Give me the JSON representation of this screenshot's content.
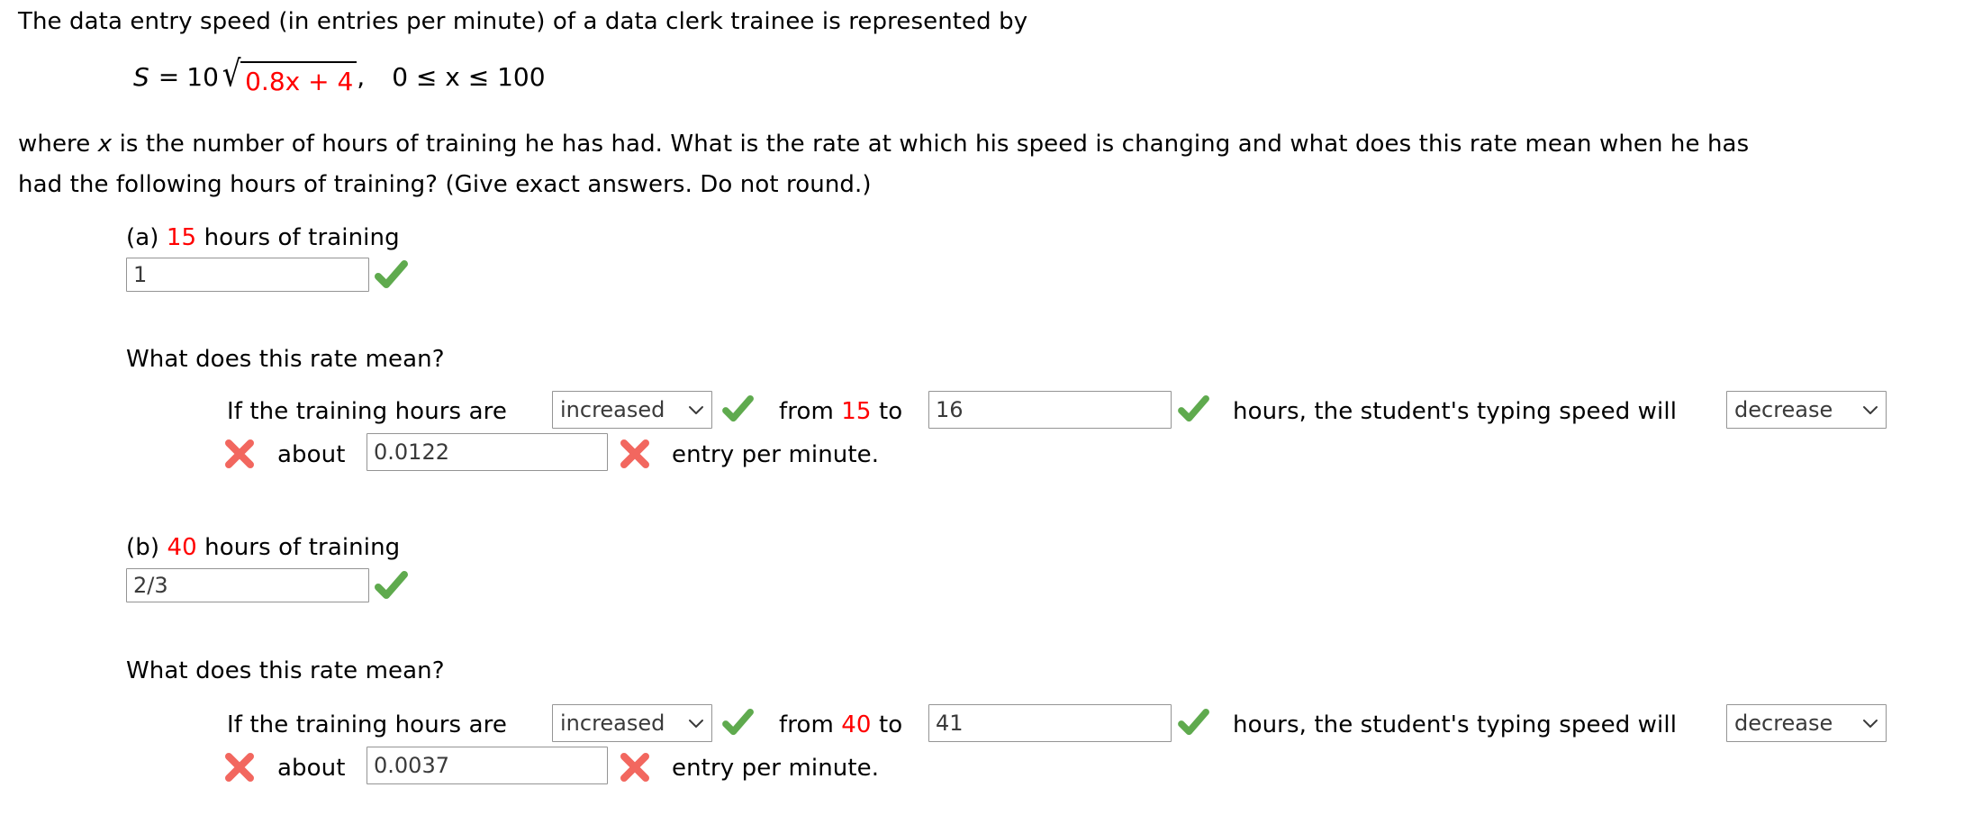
{
  "problem": {
    "intro": "The data entry speed (in entries per minute) of a data clerk trainee is represented by",
    "formula": {
      "lhs": "S",
      "equals": "=",
      "coefficient": "10",
      "radicand": "0.8x + 4",
      "comma": ",",
      "domain": "0 ≤ x ≤ 100"
    },
    "body_line1": "where x is the number of hours of training he has had. What is the rate at which his speed is changing and what does this rate mean when he has",
    "body_line1_prefix": "where ",
    "body_line1_var": "x",
    "body_line1_rest": " is the number of hours of training he has had. What is the rate at which his speed is changing and what does this rate mean when he has",
    "body_line2": "had the following hours of training? (Give exact answers. Do not round.)"
  },
  "parts": [
    {
      "label": "(a)",
      "hours": "15",
      "hours_suffix": "hours of training",
      "answer_value": "1",
      "answer_status": "correct",
      "rate_question": "What does this rate mean?",
      "sentence": {
        "lead": "If the training hours are",
        "direction_select": "increased",
        "direction_status": "correct",
        "from_word": "from",
        "from_value": "15",
        "to_word": "to",
        "to_value": "16",
        "to_status": "correct",
        "mid": "hours, the student's typing speed will",
        "change_select": "decrease",
        "about_status": "incorrect",
        "about_word": "about",
        "amount_value": "0.0122",
        "amount_status": "incorrect",
        "tail": "entry per minute."
      }
    },
    {
      "label": "(b)",
      "hours": "40",
      "hours_suffix": "hours of training",
      "answer_value": "2/3",
      "answer_status": "correct",
      "rate_question": "What does this rate mean?",
      "sentence": {
        "lead": "If the training hours are",
        "direction_select": "increased",
        "direction_status": "correct",
        "from_word": "from",
        "from_value": "40",
        "to_word": "to",
        "to_value": "41",
        "to_status": "correct",
        "mid": "hours, the student's typing speed will",
        "change_select": "decrease",
        "about_status": "incorrect",
        "about_word": "about",
        "amount_value": "0.0037",
        "amount_status": "incorrect",
        "tail": "entry per minute."
      }
    }
  ],
  "colors": {
    "highlight_red": "#ff0000",
    "correct_green": "#5faa4e",
    "incorrect_red": "#f2675f",
    "field_border": "#949494",
    "field_text": "#3a3a3a"
  },
  "icons": {
    "checkmark": "check-icon",
    "cross": "cross-icon",
    "caret": "chevron-down-icon"
  }
}
